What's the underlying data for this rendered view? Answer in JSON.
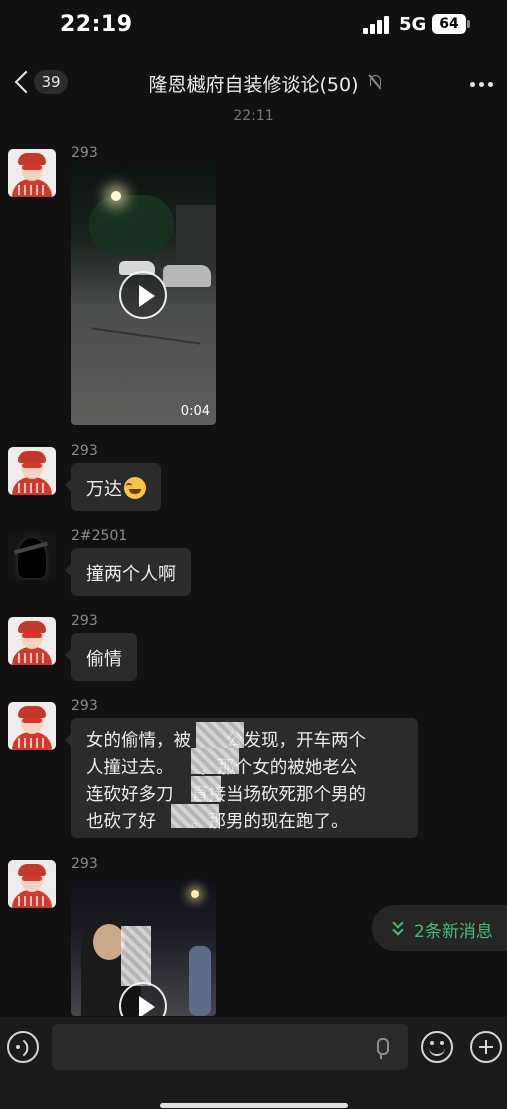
{
  "status_bar": {
    "time": "22:19",
    "network": "5G",
    "battery": "64"
  },
  "nav": {
    "back_count": "39",
    "title": "隆恩樾府自装修谈论(50)"
  },
  "timestamp": "22:11",
  "messages": [
    {
      "sender": "293",
      "type": "video",
      "duration": "0:04"
    },
    {
      "sender": "293",
      "type": "text",
      "text": "万达"
    },
    {
      "sender": "2#2501",
      "type": "text",
      "text": "撞两个人啊"
    },
    {
      "sender": "293",
      "type": "text",
      "text": "偷情"
    },
    {
      "sender": "293",
      "type": "text",
      "lines": [
        "女的偷情，被　　公发现，开车两个",
        "人撞过去。　　，那个女的被她老公",
        "连砍好多刀　直接当场砍死那个男的",
        "也砍了好　　。那男的现在跑了。"
      ]
    },
    {
      "sender": "293",
      "type": "video"
    }
  ],
  "new_messages": "2条新消息",
  "input": {
    "placeholder": ""
  },
  "icons": [
    "back-icon",
    "mute-icon",
    "more-icon",
    "play-icon",
    "laughing-emoji-icon",
    "voice-icon",
    "mic-icon",
    "emoji-icon",
    "plus-icon"
  ]
}
